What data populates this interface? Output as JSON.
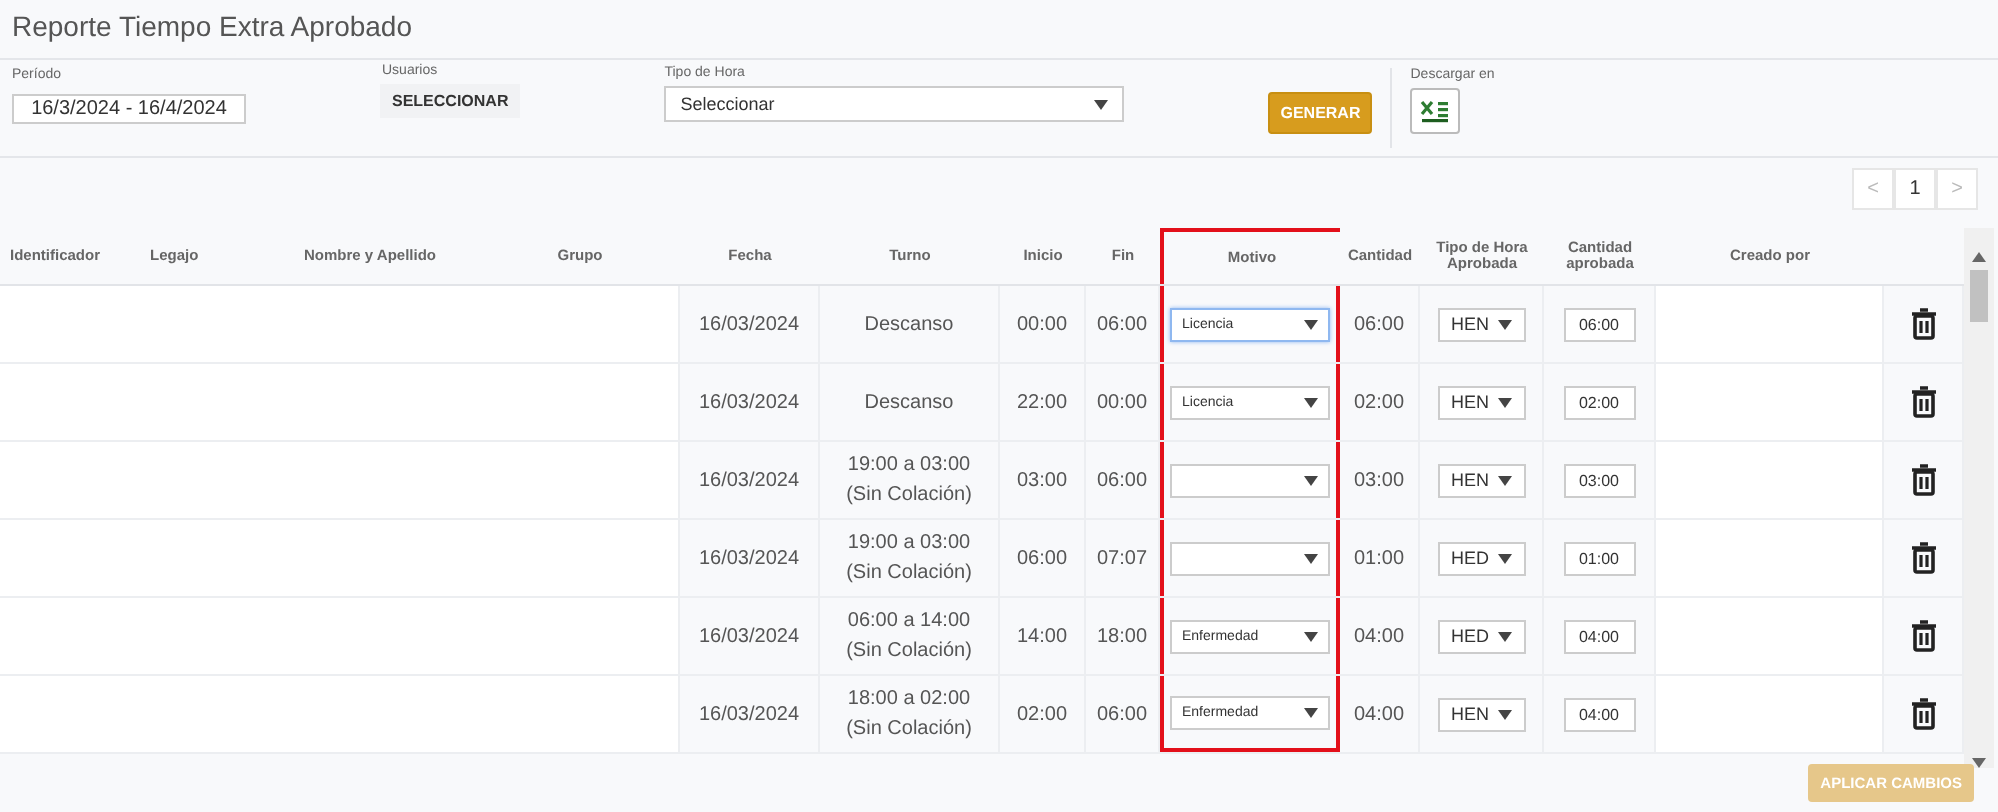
{
  "title": "Reporte Tiempo Extra Aprobado",
  "filters": {
    "period": {
      "label": "Período",
      "value": "16/3/2024 - 16/4/2024"
    },
    "users": {
      "label": "Usuarios",
      "button": "SELECCIONAR"
    },
    "hour_type": {
      "label": "Tipo de Hora",
      "value": "Seleccionar"
    },
    "generate_button": "GENERAR",
    "download": {
      "label": "Descargar en"
    }
  },
  "pagination": {
    "prev": "<",
    "page": "1",
    "next": ">"
  },
  "table": {
    "columns": [
      {
        "label": "Identificador",
        "highlighted": false
      },
      {
        "label": "Legajo",
        "highlighted": false
      },
      {
        "label": "Nombre y Apellido",
        "highlighted": false
      },
      {
        "label": "Grupo",
        "highlighted": false
      },
      {
        "label": "Fecha",
        "highlighted": false
      },
      {
        "label": "Turno",
        "highlighted": false
      },
      {
        "label": "Inicio",
        "highlighted": false
      },
      {
        "label": "Fin",
        "highlighted": false
      },
      {
        "label": "Motivo",
        "highlighted": true
      },
      {
        "label": "Cantidad",
        "highlighted": false
      },
      {
        "label": "Tipo de Hora Aprobada",
        "highlighted": false
      },
      {
        "label": "Cantidad aprobada",
        "highlighted": false
      },
      {
        "label": "Creado por",
        "highlighted": false
      }
    ],
    "rows": [
      {
        "fecha": "16/03/2024",
        "turno": "Descanso",
        "inicio": "00:00",
        "fin": "06:00",
        "motivo": "Licencia",
        "motivo_focused": true,
        "cantidad": "06:00",
        "tipo": "HEN",
        "cantidad_aprobada": "06:00"
      },
      {
        "fecha": "16/03/2024",
        "turno": "Descanso",
        "inicio": "22:00",
        "fin": "00:00",
        "motivo": "Licencia",
        "motivo_focused": false,
        "cantidad": "02:00",
        "tipo": "HEN",
        "cantidad_aprobada": "02:00"
      },
      {
        "fecha": "16/03/2024",
        "turno": "19:00 a 03:00 (Sin Colación)",
        "inicio": "03:00",
        "fin": "06:00",
        "motivo_focused": false,
        "cantidad": "03:00",
        "tipo": "HEN",
        "cantidad_aprobada": "03:00"
      },
      {
        "fecha": "16/03/2024",
        "turno": "19:00 a 03:00 (Sin Colación)",
        "inicio": "06:00",
        "fin": "07:07",
        "motivo_focused": false,
        "cantidad": "01:00",
        "tipo": "HED",
        "cantidad_aprobada": "01:00"
      },
      {
        "fecha": "16/03/2024",
        "turno": "06:00 a 14:00 (Sin Colación)",
        "inicio": "14:00",
        "fin": "18:00",
        "motivo": "Enfermedad",
        "motivo_focused": false,
        "cantidad": "04:00",
        "tipo": "HED",
        "cantidad_aprobada": "04:00"
      },
      {
        "fecha": "16/03/2024",
        "turno": "18:00 a 02:00 (Sin Colación)",
        "inicio": "02:00",
        "fin": "06:00",
        "motivo": "Enfermedad",
        "motivo_focused": false,
        "cantidad": "04:00",
        "tipo": "HEN",
        "cantidad_aprobada": "04:00"
      }
    ]
  },
  "apply_button": {
    "label": "APLICAR CAMBIOS",
    "disabled": true
  }
}
